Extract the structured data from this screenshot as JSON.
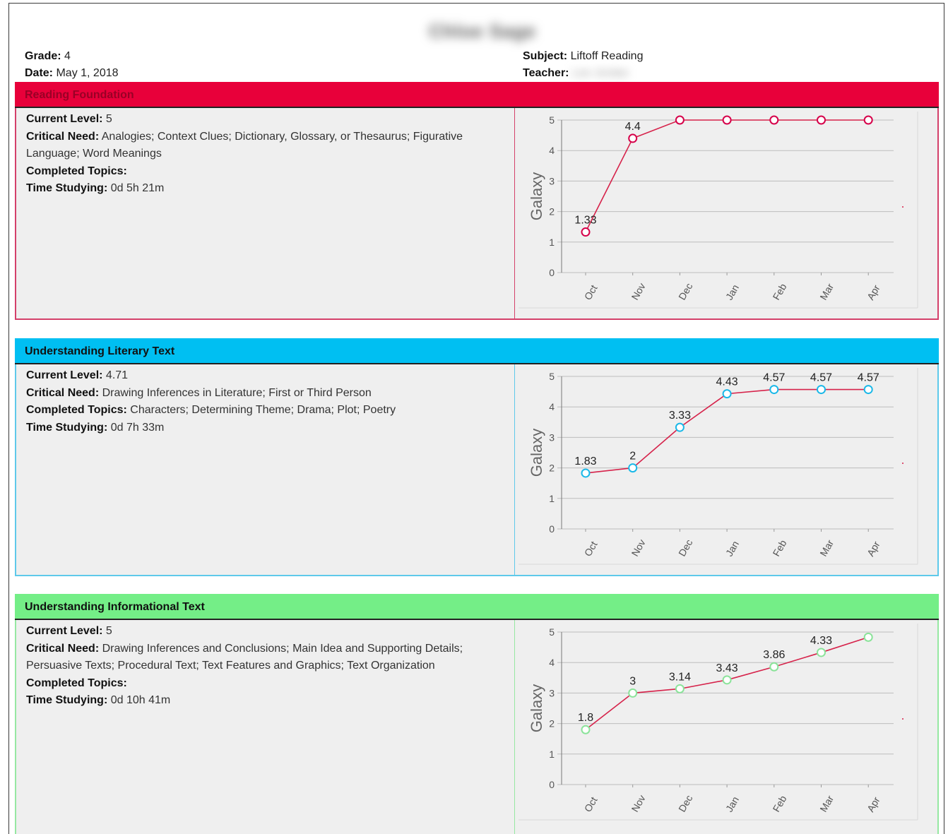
{
  "header": {
    "student_name": "Chloe Sage",
    "grade_label": "Grade:",
    "grade_value": "4",
    "date_label": "Date:",
    "date_value": "May 1, 2018",
    "subject_label": "Subject:",
    "subject_value": "Liftoff Reading",
    "teacher_label": "Teacher:",
    "teacher_value": "Lee Jordan"
  },
  "labels": {
    "current_level": "Current Level:",
    "critical_need": "Critical Need:",
    "completed_topics": "Completed Topics:",
    "time_studying": "Time Studying:"
  },
  "colors": {
    "line": "#d6224a",
    "reading_foundation": "#e8003a",
    "literary_text": "#00bff2",
    "informational_text": "#74ee87"
  },
  "sections": [
    {
      "title": "Reading Foundation",
      "current_level": "5",
      "critical_need": "Analogies; Context Clues; Dictionary, Glossary, or Thesaurus; Figurative Language; Word Meanings",
      "completed_topics": "",
      "time_studying": "0d 5h 21m"
    },
    {
      "title": "Understanding Literary Text",
      "current_level": "4.71",
      "critical_need": "Drawing Inferences in Literature; First or Third Person",
      "completed_topics": "Characters; Determining Theme; Drama; Plot; Poetry",
      "time_studying": "0d 7h 33m"
    },
    {
      "title": "Understanding Informational Text",
      "current_level": "5",
      "critical_need": "Drawing Inferences and Conclusions; Main Idea and Supporting Details; Persuasive Texts; Procedural Text; Text Features and Graphics; Text Organization",
      "completed_topics": "",
      "time_studying": "0d 10h 41m"
    }
  ],
  "chart_data": [
    {
      "type": "line",
      "categories": [
        "Oct",
        "Nov",
        "Dec",
        "Jan",
        "Feb",
        "Mar",
        "Apr"
      ],
      "values": [
        1.33,
        4.4,
        5,
        5,
        5,
        5,
        5
      ],
      "data_labels": [
        "1.33",
        "4.4",
        "",
        "",
        "",
        "",
        ""
      ],
      "ylabel": "Galaxy",
      "yticks": [
        "0",
        "1",
        "2",
        "3",
        "4",
        "5"
      ],
      "ylim": [
        0,
        5
      ],
      "grid": true,
      "marker_color": "#d6004a",
      "line_color": "#d6224a"
    },
    {
      "type": "line",
      "categories": [
        "Oct",
        "Nov",
        "Dec",
        "Jan",
        "Feb",
        "Mar",
        "Apr"
      ],
      "values": [
        1.83,
        2,
        3.33,
        4.43,
        4.57,
        4.57,
        4.57
      ],
      "data_labels": [
        "1.83",
        "2",
        "3.33",
        "4.43",
        "4.57",
        "4.57",
        "4.57"
      ],
      "ylabel": "Galaxy",
      "yticks": [
        "0",
        "1",
        "2",
        "3",
        "4",
        "5"
      ],
      "ylim": [
        0,
        5
      ],
      "grid": true,
      "marker_color": "#1ab8e8",
      "line_color": "#d6224a"
    },
    {
      "type": "line",
      "categories": [
        "Oct",
        "Nov",
        "Dec",
        "Jan",
        "Feb",
        "Mar",
        "Apr"
      ],
      "values": [
        1.8,
        3,
        3.14,
        3.43,
        3.86,
        4.33,
        4.83
      ],
      "data_labels": [
        "1.8",
        "3",
        "3.14",
        "3.43",
        "3.86",
        "4.33",
        ""
      ],
      "ylabel": "Galaxy",
      "yticks": [
        "0",
        "1",
        "2",
        "3",
        "4",
        "5"
      ],
      "ylim": [
        0,
        5
      ],
      "grid": true,
      "marker_color": "#8be39a",
      "line_color": "#d6224a"
    }
  ]
}
